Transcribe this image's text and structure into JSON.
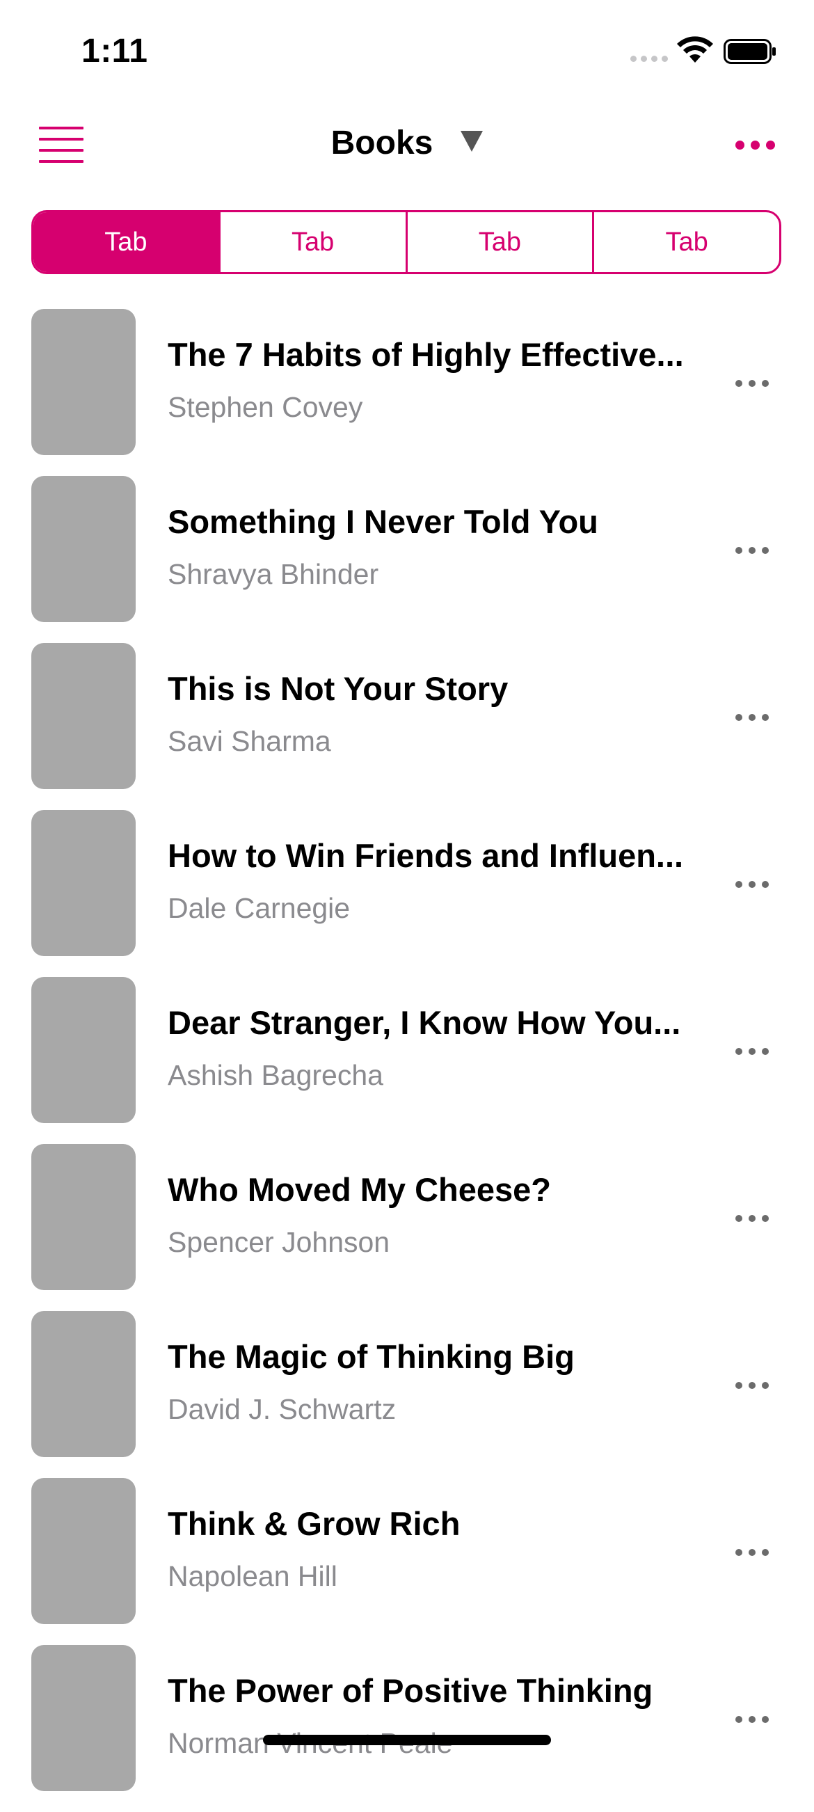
{
  "status_bar": {
    "time": "1:11"
  },
  "nav": {
    "title": "Books",
    "accent_color": "#d6006f",
    "icons": {
      "menu": "hamburger-menu-icon",
      "dropdown": "caret-down-icon",
      "more": "more-horizontal-icon"
    }
  },
  "tabs": [
    {
      "label": "Tab",
      "active": true
    },
    {
      "label": "Tab",
      "active": false
    },
    {
      "label": "Tab",
      "active": false
    },
    {
      "label": "Tab",
      "active": false
    }
  ],
  "books": [
    {
      "title": "The 7 Habits of Highly Effective...",
      "author": "Stephen Covey"
    },
    {
      "title": "Something I Never Told You",
      "author": "Shravya Bhinder"
    },
    {
      "title": "This is Not Your Story",
      "author": "Savi Sharma"
    },
    {
      "title": "How to Win Friends and Influen...",
      "author": "Dale Carnegie"
    },
    {
      "title": "Dear Stranger, I Know How You...",
      "author": "Ashish Bagrecha"
    },
    {
      "title": "Who Moved My Cheese?",
      "author": "Spencer Johnson"
    },
    {
      "title": "The Magic of Thinking Big",
      "author": "David J. Schwartz"
    },
    {
      "title": "Think & Grow Rich",
      "author": "Napolean Hill"
    },
    {
      "title": "The Power of Positive Thinking",
      "author": "Norman Vincent Peale"
    }
  ]
}
